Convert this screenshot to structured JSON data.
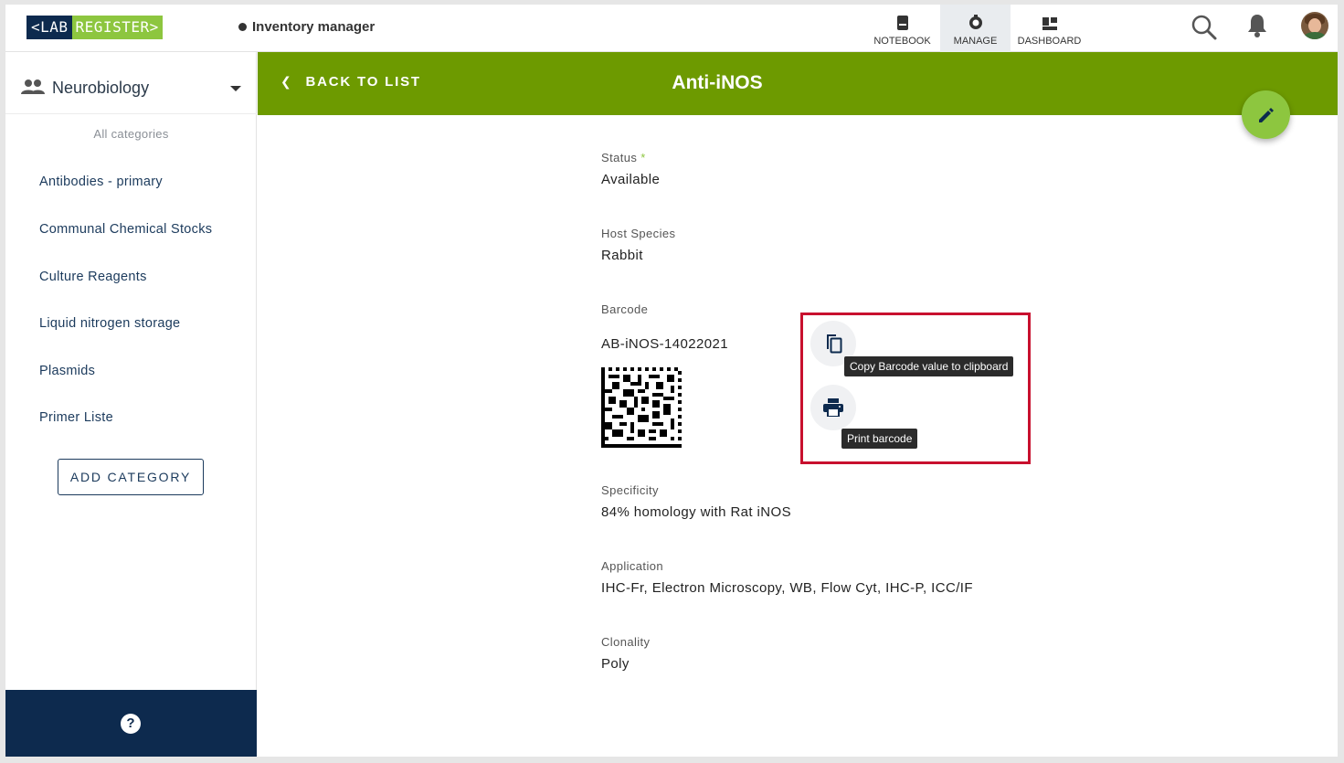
{
  "logo": {
    "part1": "<LAB",
    "part2": "REGISTER>"
  },
  "app_name": "Inventory manager",
  "nav": {
    "notebook": "NOTEBOOK",
    "manage": "MANAGE",
    "dashboard": "DASHBOARD",
    "active": "MANAGE"
  },
  "icons": {
    "search": "search-icon",
    "notifications": "bell-icon",
    "user": "avatar",
    "workspace": "people-icon",
    "edit": "pencil-icon",
    "copy": "copy-icon",
    "print": "printer-icon",
    "help": "help-icon"
  },
  "sidebar": {
    "workspace": "Neurobiology",
    "all_categories": "All categories",
    "categories": [
      "Antibodies - primary",
      "Communal Chemical Stocks",
      "Culture Reagents",
      "Liquid nitrogen storage",
      "Plasmids",
      "Primer Liste"
    ],
    "add_category": "ADD CATEGORY",
    "help": "?"
  },
  "header": {
    "back": "BACK TO LIST",
    "title": "Anti-iNOS"
  },
  "fields": {
    "status": {
      "label": "Status",
      "required_mark": "*",
      "value": "Available"
    },
    "host_species": {
      "label": "Host Species",
      "value": "Rabbit"
    },
    "barcode": {
      "label": "Barcode",
      "value": "AB-iNOS-14022021"
    },
    "specificity": {
      "label": "Specificity",
      "value": "84% homology with Rat iNOS"
    },
    "application": {
      "label": "Application",
      "value": "IHC-Fr, Electron Microscopy, WB, Flow Cyt, IHC-P, ICC/IF"
    },
    "clonality": {
      "label": "Clonality",
      "value": "Poly"
    }
  },
  "tooltips": {
    "copy": "Copy Barcode value to clipboard",
    "print": "Print barcode"
  },
  "colors": {
    "header_green": "#6d9a00",
    "accent_green": "#8dc63f",
    "navy": "#0d2a4e",
    "highlight_red": "#c8102e"
  }
}
